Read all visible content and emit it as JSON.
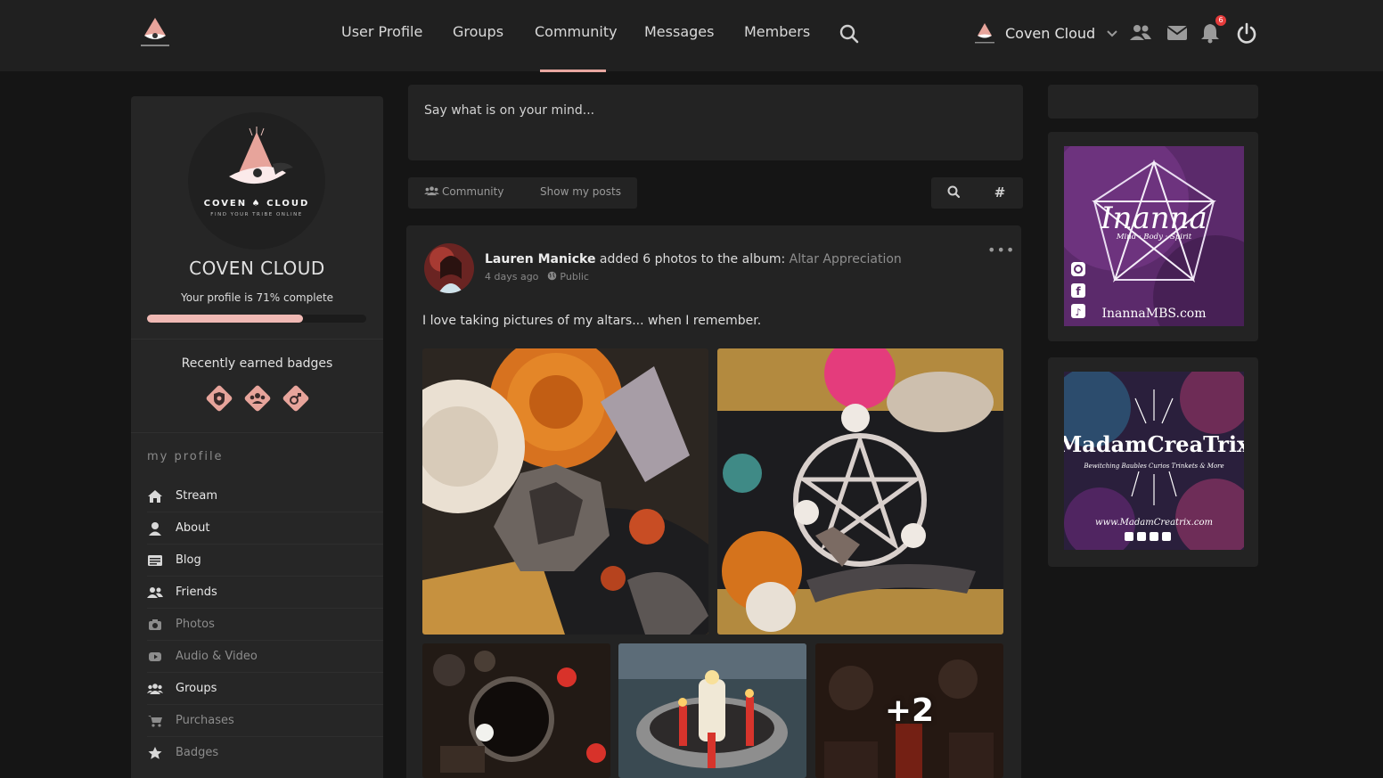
{
  "nav": {
    "items": [
      {
        "label": "User Profile"
      },
      {
        "label": "Groups"
      },
      {
        "label": "Community"
      },
      {
        "label": "Messages"
      },
      {
        "label": "Members"
      }
    ],
    "active": "Community",
    "site_name": "Coven Cloud",
    "notification_count": "6"
  },
  "sidebar": {
    "logo_text": "COVEN",
    "logo_text_2": "CLOUD",
    "logo_tagline": "FIND YOUR TRIBE ONLINE",
    "profile_name": "COVEN CLOUD",
    "profile_complete": "Your profile is 71% complete",
    "profile_percent": 71,
    "badges_title": "Recently earned badges",
    "section_label": "my profile",
    "menu": [
      {
        "label": "Stream",
        "icon": "home-icon",
        "state": "active"
      },
      {
        "label": "About",
        "icon": "user-icon",
        "state": "active"
      },
      {
        "label": "Blog",
        "icon": "blog-icon",
        "state": "active"
      },
      {
        "label": "Friends",
        "icon": "friends-icon",
        "state": "active"
      },
      {
        "label": "Photos",
        "icon": "camera-icon",
        "state": "muted"
      },
      {
        "label": "Audio & Video",
        "icon": "video-icon",
        "state": "muted"
      },
      {
        "label": "Groups",
        "icon": "groups-icon",
        "state": "active"
      },
      {
        "label": "Purchases",
        "icon": "cart-icon",
        "state": "muted"
      },
      {
        "label": "Badges",
        "icon": "star-icon",
        "state": "muted"
      }
    ]
  },
  "composer": {
    "placeholder": "Say what is on your mind..."
  },
  "filters": {
    "community": "Community",
    "my_posts": "Show my posts",
    "hashtag": "#"
  },
  "post": {
    "author": "Lauren Manicke",
    "action": "added 6 photos to the album:",
    "album": "Altar Appreciation",
    "time": "4 days ago",
    "visibility": "Public",
    "text": "I love taking pictures of my altars... when I remember.",
    "more_photos": "+2"
  },
  "ads": [
    {
      "title": "Inanna",
      "subtitle": "Mind · Body · Spirit",
      "url": "InannaMBS.com"
    },
    {
      "title": "MadamCreaTrix",
      "subtitle": "Bewitching Baubles Curios Trinkets & More",
      "url": "www.MadamCreatrix.com"
    }
  ],
  "colors": {
    "accent": "#e8a7a0",
    "background": "#151515",
    "panel": "#232323",
    "notification": "#e53b3b"
  }
}
